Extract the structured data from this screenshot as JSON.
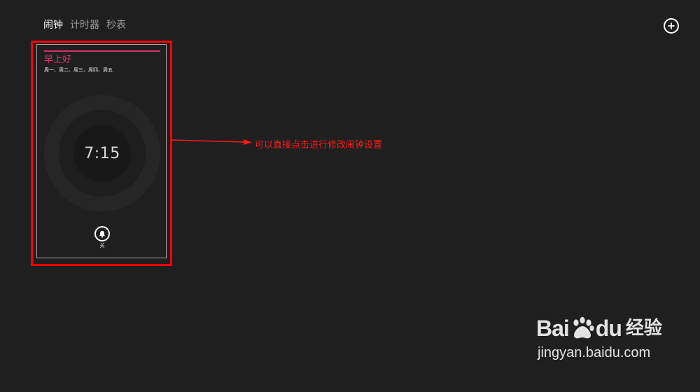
{
  "tabs": [
    {
      "label": "闹钟",
      "active": true
    },
    {
      "label": "计时器",
      "active": false
    },
    {
      "label": "秒表",
      "active": false
    }
  ],
  "add_button": {
    "icon": "plus-circle-icon"
  },
  "alarm": {
    "name": "早上好",
    "days": "周一、周二、周三、周四、周五",
    "time": "7:15",
    "status_label": "关",
    "bell_icon": "bell-icon",
    "accent_color": "#e0316b"
  },
  "annotation": {
    "text": "可以直接点击进行修改闹钟设置",
    "color": "#ff1a1a"
  },
  "watermark": {
    "brand_left": "Bai",
    "brand_right": "du",
    "brand_cn": "经验",
    "url": "jingyan.baidu.com"
  }
}
